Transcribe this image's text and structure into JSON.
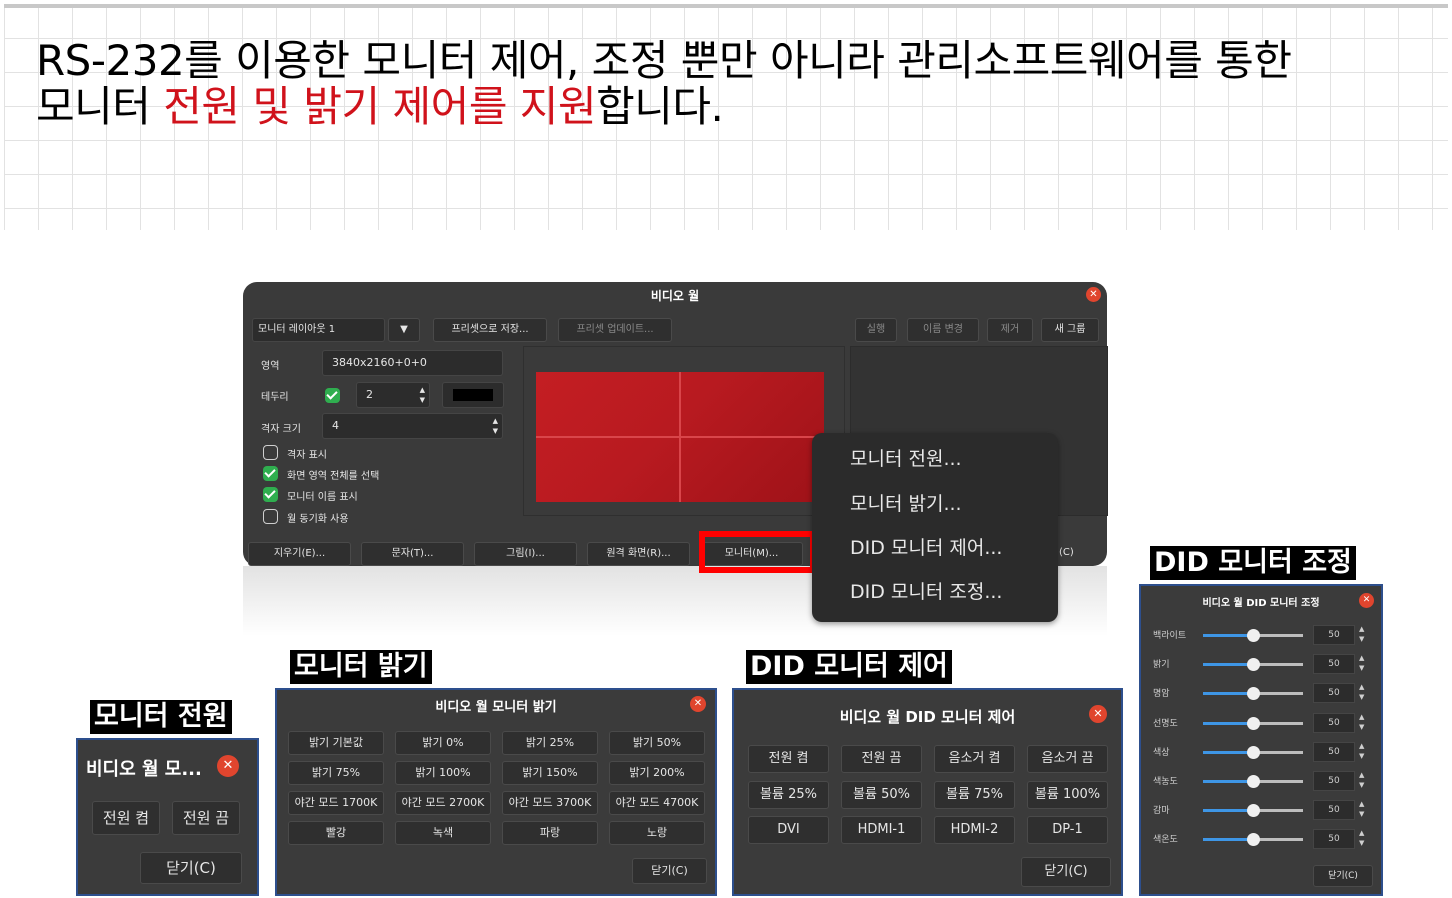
{
  "headline": {
    "line1": "RS-232를 이용한 모니터 제어, 조정 뿐만 아니라 관리소프트웨어를 통한",
    "line2_a": "모니터 ",
    "line2_red": "전원 및 밝기 제어를 지원",
    "line2_b": "합니다."
  },
  "main_window": {
    "title": "비디오 월",
    "layout_select": "모니터 레이아웃 1",
    "save_preset": "프리셋으로 저장...",
    "update_preset": "프리셋 업데이트...",
    "run": "실행",
    "rename": "이름 변경",
    "remove": "제거",
    "new_group": "새 그룹",
    "area_label": "영역",
    "area_value": "3840x2160+0+0",
    "border_label": "테두리",
    "border_value": "2",
    "grid_size_label": "격자 크기",
    "grid_size_value": "4",
    "show_grid": "격자 표시",
    "select_whole_screen": "화면 영역 전체를 선택",
    "show_monitor_names": "모니터 이름 표시",
    "use_wall_sync": "월 동기화 사용",
    "bottom_buttons": [
      "지우기(E)...",
      "문자(T)...",
      "그림(I)...",
      "원격 화면(R)...",
      "모니터(M)..."
    ],
    "close_partial": "(C)"
  },
  "context_menu": {
    "items": [
      "모니터 전원...",
      "모니터 밝기...",
      "DID 모니터 제어...",
      "DID 모니터 조정..."
    ]
  },
  "power_dialog": {
    "section_label": "모니터 전원",
    "title": "비디오 월 모...",
    "on": "전원 켬",
    "off": "전원 끔",
    "close": "닫기(C)"
  },
  "brightness_dialog": {
    "section_label": "모니터 밝기",
    "title": "비디오 월 모니터 밝기",
    "buttons": [
      "밝기 기본값",
      "밝기 0%",
      "밝기 25%",
      "밝기 50%",
      "밝기 75%",
      "밝기 100%",
      "밝기 150%",
      "밝기 200%",
      "야간 모드 1700K",
      "야간 모드 2700K",
      "야간 모드 3700K",
      "야간 모드 4700K",
      "빨강",
      "녹색",
      "파랑",
      "노랑"
    ],
    "close": "닫기(C)"
  },
  "did_control_dialog": {
    "section_label": "DID 모니터 제어",
    "title": "비디오 월 DID 모니터 제어",
    "buttons": [
      "전원 켬",
      "전원 끔",
      "음소거 켬",
      "음소거 끔",
      "볼륨 25%",
      "볼륨 50%",
      "볼륨 75%",
      "볼륨 100%",
      "DVI",
      "HDMI-1",
      "HDMI-2",
      "DP-1"
    ],
    "close": "닫기(C)"
  },
  "did_adjust_dialog": {
    "section_label": "DID 모니터 조정",
    "title": "비디오 월 DID 모니터 조정",
    "rows": [
      {
        "label": "백라이트",
        "value": "50"
      },
      {
        "label": "밝기",
        "value": "50"
      },
      {
        "label": "명암",
        "value": "50"
      },
      {
        "label": "선명도",
        "value": "50"
      },
      {
        "label": "색상",
        "value": "50"
      },
      {
        "label": "색농도",
        "value": "50"
      },
      {
        "label": "감마",
        "value": "50"
      },
      {
        "label": "색온도",
        "value": "50"
      }
    ],
    "close": "닫기(C)"
  },
  "colors": {
    "accent_red": "#d0121b",
    "window_bg": "#3b3b3b",
    "close_button": "#e0452e",
    "check_green": "#2fae4f",
    "slider_blue": "#3e96e6",
    "frame_blue": "#2d4f8d"
  }
}
